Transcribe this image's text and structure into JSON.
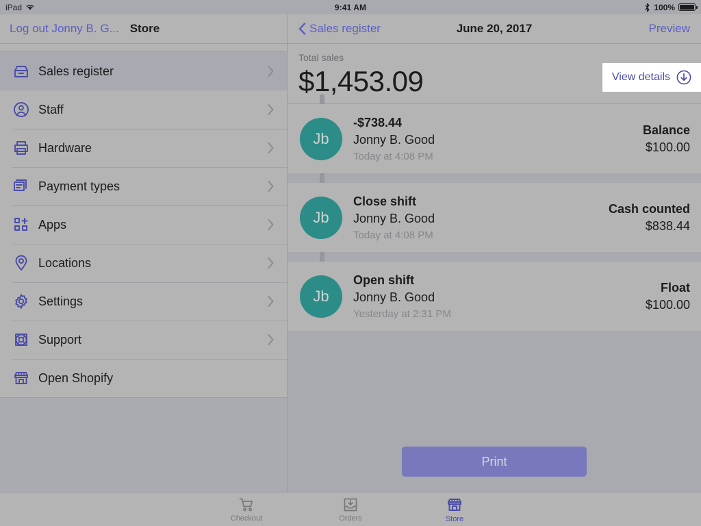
{
  "status_bar": {
    "device": "iPad",
    "wifi_icon": "wifi-icon",
    "time": "9:41 AM",
    "bluetooth_icon": "bluetooth-icon",
    "battery_percent": "100%",
    "battery_level": 100
  },
  "sidebar": {
    "logout_label": "Log out Jonny B. G...",
    "store_title": "Store",
    "items": [
      {
        "label": "Sales register",
        "icon": "cash-register-icon",
        "selected": true,
        "chevron": true
      },
      {
        "label": "Staff",
        "icon": "staff-person-icon",
        "selected": false,
        "chevron": true
      },
      {
        "label": "Hardware",
        "icon": "printer-icon",
        "selected": false,
        "chevron": true
      },
      {
        "label": "Payment types",
        "icon": "payment-card-icon",
        "selected": false,
        "chevron": true
      },
      {
        "label": "Apps",
        "icon": "apps-grid-plus-icon",
        "selected": false,
        "chevron": true
      },
      {
        "label": "Locations",
        "icon": "location-pin-icon",
        "selected": false,
        "chevron": true
      },
      {
        "label": "Settings",
        "icon": "gear-icon",
        "selected": false,
        "chevron": true
      },
      {
        "label": "Support",
        "icon": "lifebuoy-icon",
        "selected": false,
        "chevron": true
      },
      {
        "label": "Open Shopify",
        "icon": "shopify-store-icon",
        "selected": false,
        "chevron": false
      }
    ]
  },
  "detail": {
    "back_label": "Sales register",
    "title": "June 20, 2017",
    "preview_label": "Preview",
    "totals": {
      "label": "Total sales",
      "amount": "$1,453.09",
      "view_details_label": "View details",
      "view_details_icon": "circle-arrow-down-icon"
    },
    "transactions": [
      {
        "avatar_initials": "Jb",
        "title": "-$738.44",
        "subtitle": "Jonny B. Good",
        "time": "Today at 4:08 PM",
        "right_label": "Balance",
        "right_value": "$100.00"
      },
      {
        "avatar_initials": "Jb",
        "title": "Close shift",
        "subtitle": "Jonny B. Good",
        "time": "Today at 4:08 PM",
        "right_label": "Cash counted",
        "right_value": "$838.44"
      },
      {
        "avatar_initials": "Jb",
        "title": "Open shift",
        "subtitle": "Jonny B. Good",
        "time": "Yesterday at 2:31 PM",
        "right_label": "Float",
        "right_value": "$100.00"
      }
    ],
    "print_label": "Print"
  },
  "tabbar": {
    "tabs": [
      {
        "label": "Checkout",
        "icon": "shopping-cart-icon",
        "active": false
      },
      {
        "label": "Orders",
        "icon": "inbox-download-icon",
        "active": false
      },
      {
        "label": "Store",
        "icon": "shopify-store-icon",
        "active": true
      }
    ]
  },
  "colors": {
    "accent_indigo": "#4a4ba8",
    "link_indigo": "#5c5fc4",
    "avatar_teal": "#2c8c87",
    "print_button": "#7779bc",
    "sidebar_bg": "#b4b4b4",
    "detail_bg": "#a9aab0",
    "selected_row": "#a8a9b1"
  }
}
